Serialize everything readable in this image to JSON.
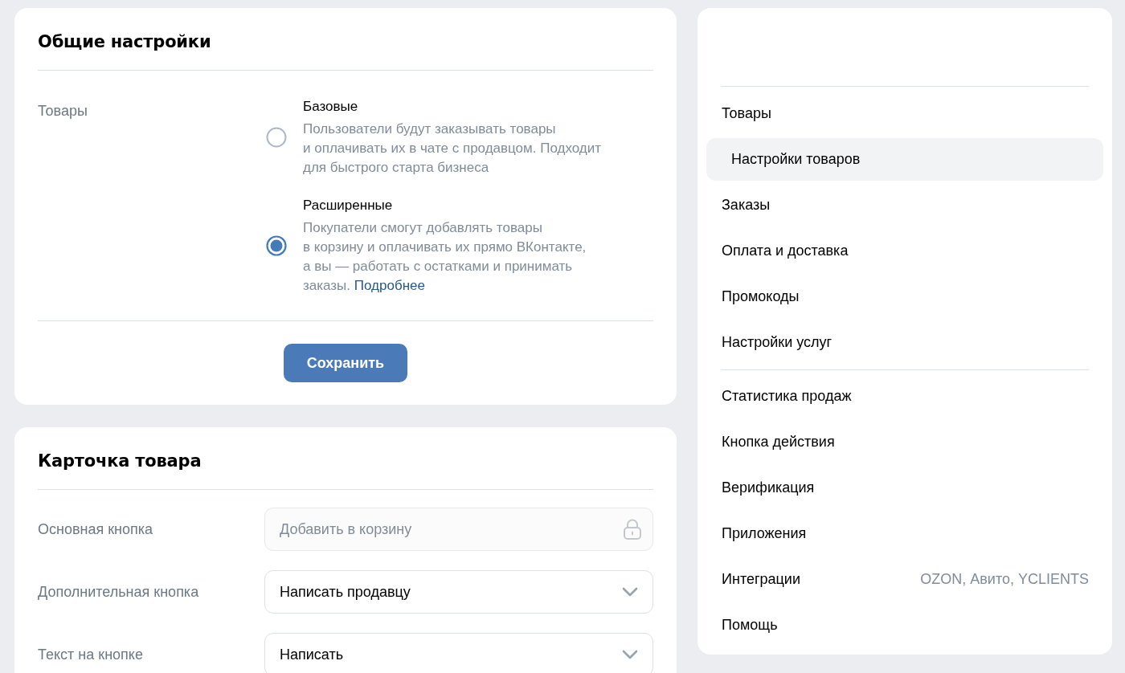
{
  "main": {
    "sections": [
      {
        "title": "Общие настройки",
        "rows": [
          {
            "kind": "radio_group",
            "label": "Товары",
            "options": [
              {
                "title": "Базовые",
                "description": [
                  "Пользователи будут заказывать товары",
                  "и оплачивать их в чате с продавцом. Подходит",
                  "для быстрого старта бизнеса"
                ],
                "selected": false
              },
              {
                "title": "Расширенные",
                "description": [
                  "Покупатели смогут добавлять товары",
                  "в корзину и оплачивать их прямо ВКонтакте,",
                  "а вы — работать с остатками и принимать",
                  "заказы."
                ],
                "link": "Подробнее",
                "selected": true
              }
            ]
          }
        ],
        "button": "Сохранить"
      },
      {
        "title": "Карточка товара",
        "rows": [
          {
            "kind": "locked",
            "label": "Основная кнопка",
            "value": "Добавить в корзину"
          },
          {
            "kind": "select",
            "label": "Дополнительная кнопка",
            "value": "Написать продавцу"
          },
          {
            "kind": "select",
            "label": "Текст на кнопке",
            "value": "Написать"
          }
        ]
      }
    ]
  },
  "sidebar": {
    "groups": [
      {
        "items": [
          {
            "label": "Товары",
            "selected": false,
            "children": [
              {
                "label": "Настройки товаров",
                "selected": true
              }
            ]
          },
          {
            "label": "Заказы",
            "selected": false
          },
          {
            "label": "Оплата и доставка",
            "selected": false
          },
          {
            "label": "Промокоды",
            "selected": false
          },
          {
            "label": "Настройки услуг",
            "selected": false
          }
        ]
      },
      {
        "items": [
          {
            "label": "Статистика продаж",
            "selected": false
          },
          {
            "label": "Кнопка действия",
            "selected": false
          },
          {
            "label": "Верификация",
            "selected": false
          },
          {
            "label": "Приложения",
            "selected": false
          },
          {
            "label": "Интеграции",
            "value": "OZON, Авито, YCLIENTS",
            "selected": false
          },
          {
            "label": "Помощь",
            "selected": false
          }
        ]
      }
    ]
  }
}
